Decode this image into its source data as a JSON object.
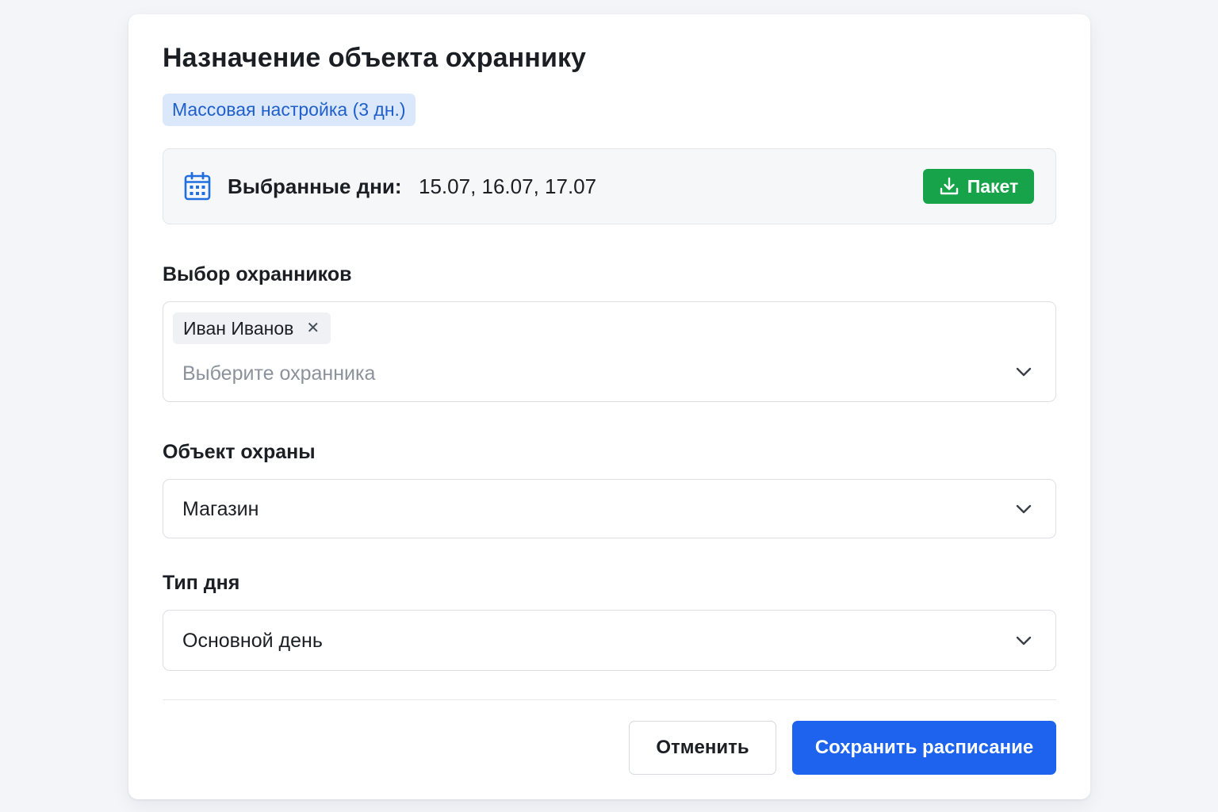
{
  "dialog": {
    "title": "Назначение объекта охраннику",
    "badge": "Массовая настройка (3 дн.)"
  },
  "selected_days": {
    "icon": "calendar-icon",
    "label": "Выбранные дни:",
    "value": "15.07, 16.07, 17.07",
    "package_button": {
      "label": "Пакет",
      "icon": "download-icon",
      "color": "#16a34a"
    }
  },
  "guards": {
    "label": "Выбор охранников",
    "selected": [
      "Иван Иванов"
    ],
    "remove_icon": "close-icon",
    "placeholder": "Выберите охранника"
  },
  "object": {
    "label": "Объект охраны",
    "value": "Магазин"
  },
  "day_type": {
    "label": "Тип дня",
    "value": "Основной день"
  },
  "footer": {
    "cancel_label": "Отменить",
    "save_label": "Сохранить расписание",
    "save_color": "#1d63ed"
  }
}
